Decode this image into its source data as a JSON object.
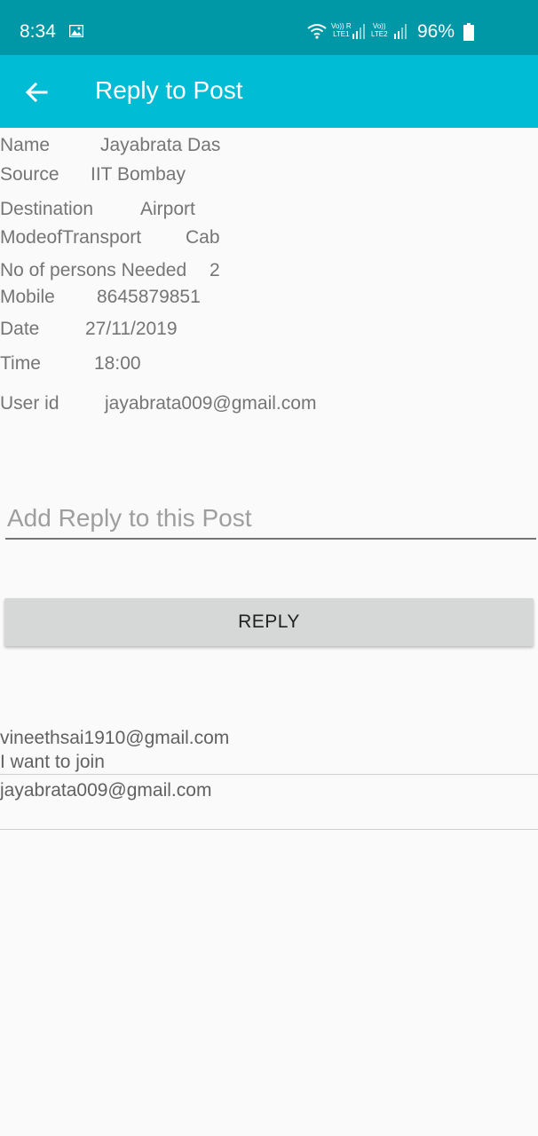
{
  "status_bar": {
    "time": "8:34",
    "lte1": "Vo)) R\nLTE1",
    "lte2": "Vo))\nLTE2",
    "battery": "96%"
  },
  "app_bar": {
    "title": "Reply to Post"
  },
  "details": {
    "name_label": "Name",
    "name_value": "Jayabrata Das",
    "source_label": "Source",
    "source_value": "IIT Bombay",
    "destination_label": "Destination",
    "destination_value": "Airport",
    "mode_label": "ModeofTransport",
    "mode_value": "Cab",
    "persons_label": "No of persons Needed",
    "persons_value": "2",
    "mobile_label": "Mobile",
    "mobile_value": "8645879851",
    "date_label": "Date",
    "date_value": "27/11/2019",
    "time_label": "Time",
    "time_value": "18:00",
    "userid_label": "User id",
    "userid_value": "jayabrata009@gmail.com"
  },
  "reply_form": {
    "placeholder": "Add Reply to this Post",
    "value": "",
    "button_label": "REPLY"
  },
  "replies": [
    {
      "user": "vineethsai1910@gmail.com",
      "message": "I want to join"
    },
    {
      "user": "jayabrata009@gmail.com",
      "message": ""
    }
  ],
  "colors": {
    "status_bar": "#0097a7",
    "app_bar": "#00bcd4",
    "background": "#fafafa",
    "button": "#d6d7d7"
  }
}
